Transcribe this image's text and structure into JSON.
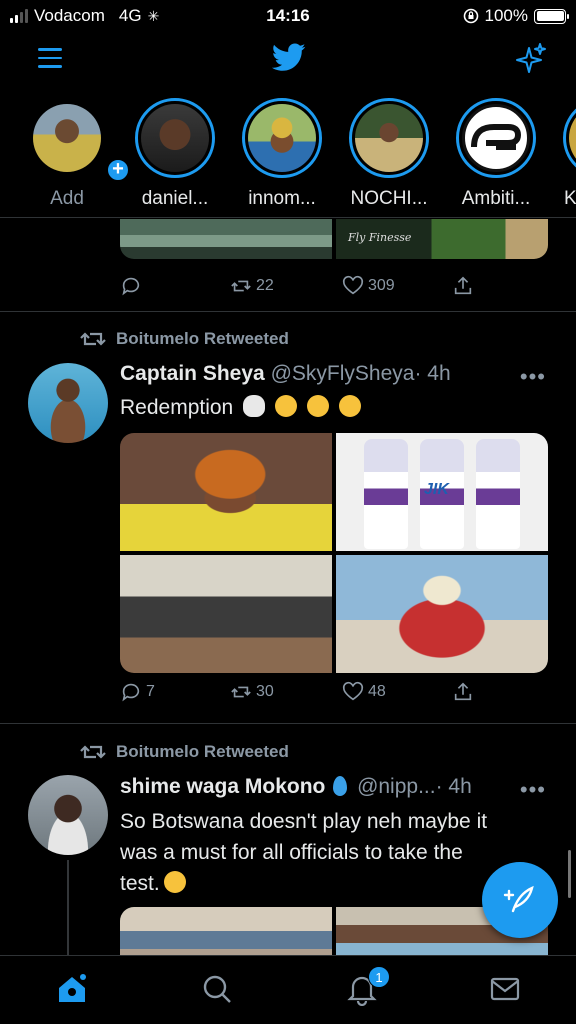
{
  "status_bar": {
    "carrier": "Vodacom",
    "network": "4G",
    "time": "14:16",
    "battery": "100%",
    "battery_level": 1.0
  },
  "nav": {
    "menu_icon": "menu-icon",
    "logo_icon": "twitter-bird-icon",
    "sparkle_icon": "sparkle-icon"
  },
  "fleets": [
    {
      "label": "Add",
      "has_add_badge": true
    },
    {
      "label": "daniel..."
    },
    {
      "label": "innom..."
    },
    {
      "label": "NOCHI..."
    },
    {
      "label": "Ambiti..."
    },
    {
      "label": "K"
    }
  ],
  "tweet0": {
    "media_caption": "Fly Finesse",
    "reply_count": "",
    "retweet_count": "22",
    "like_count": "309"
  },
  "tweet1": {
    "retweeted_by": "Boitumelo Retweeted",
    "name": "Captain Sheya",
    "handle": "@SkyFlySheya",
    "time": "· 4h",
    "text": "Redemption",
    "emojis": [
      "skull-emoji",
      "joy-emoji",
      "joy-emoji",
      "shush-emoji"
    ],
    "image_text": "JIK",
    "reply_count": "7",
    "retweet_count": "30",
    "like_count": "48"
  },
  "tweet2": {
    "retweeted_by": "Boitumelo Retweeted",
    "name": "shime waga Mokono",
    "handle": "@nipp...",
    "time": "· 4h",
    "text_lines": [
      "So Botswana doesn't play neh maybe it",
      "was a must for all officials to take the",
      "test."
    ],
    "emojis": [
      "droplet-emoji",
      "sweat-smile-emoji"
    ]
  },
  "more": "•••",
  "bottom_nav": {
    "notifications_badge": "1"
  },
  "colors": {
    "accent": "#1d9bf0",
    "background": "#000000",
    "secondary_text": "#8b98a5",
    "divider": "#2f3336"
  }
}
